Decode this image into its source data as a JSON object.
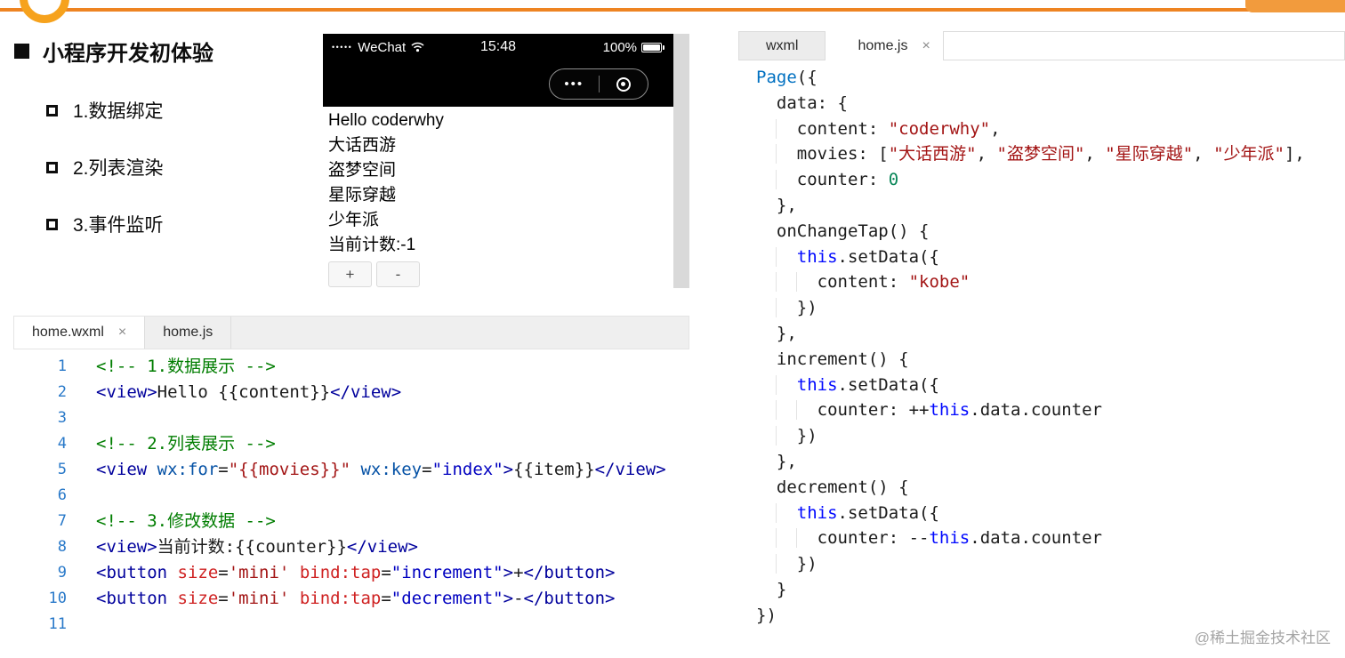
{
  "colors": {
    "accent_orange": "#ee8422",
    "comment_green": "#007d00",
    "tag_navy": "#00009c",
    "string_red": "#a31515",
    "number_green": "#098658",
    "keyword_blue": "#0008ff",
    "line_number_blue": "#2979c9"
  },
  "icons": {
    "close": "×",
    "capsule_dots": "•••",
    "signal_dots": "•••••"
  },
  "watermark": "@稀土掘金技术社区",
  "outline": {
    "title": "小程序开发初体验",
    "items": [
      "1.数据绑定",
      "2.列表渲染",
      "3.事件监听"
    ]
  },
  "phone": {
    "status": {
      "carrier": "WeChat",
      "time": "15:48",
      "battery": "100%"
    },
    "content_lines": [
      "Hello coderwhy",
      "大话西游",
      "盗梦空间",
      "星际穿越",
      "少年派",
      "当前计数:-1"
    ],
    "buttons": [
      "+",
      "-"
    ]
  },
  "wxml_editor": {
    "tabs": [
      {
        "label": "home.wxml",
        "active": true
      },
      {
        "label": "home.js",
        "active": false
      }
    ],
    "code": [
      {
        "n": "1",
        "tokens": [
          [
            "<!-- 1.数据展示 -->",
            "c"
          ]
        ]
      },
      {
        "n": "2",
        "tokens": [
          [
            "<view>",
            "t"
          ],
          [
            "Hello {{content}}",
            "p"
          ],
          [
            "</view>",
            "t"
          ]
        ]
      },
      {
        "n": "3",
        "tokens": []
      },
      {
        "n": "4",
        "tokens": [
          [
            "<!-- 2.列表展示 -->",
            "c"
          ]
        ]
      },
      {
        "n": "5",
        "tokens": [
          [
            "<view ",
            "t"
          ],
          [
            "wx:for",
            "a"
          ],
          [
            "=",
            "p"
          ],
          [
            "\"{{movies}}\"",
            "s"
          ],
          [
            " ",
            "p"
          ],
          [
            "wx:key",
            "a"
          ],
          [
            "=",
            "p"
          ],
          [
            "\"index\"",
            "sb"
          ],
          [
            ">",
            "t"
          ],
          [
            "{{item}}",
            "p"
          ],
          [
            "</view>",
            "t"
          ]
        ]
      },
      {
        "n": "6",
        "tokens": []
      },
      {
        "n": "7",
        "tokens": [
          [
            "<!-- 3.修改数据 -->",
            "c"
          ]
        ]
      },
      {
        "n": "8",
        "tokens": [
          [
            "<view>",
            "t"
          ],
          [
            "当前计数:{{counter}}",
            "p"
          ],
          [
            "</view>",
            "t"
          ]
        ]
      },
      {
        "n": "9",
        "tokens": [
          [
            "<button ",
            "t"
          ],
          [
            "size",
            "ar"
          ],
          [
            "=",
            "p"
          ],
          [
            "'mini'",
            "s"
          ],
          [
            " ",
            "p"
          ],
          [
            "bind:tap",
            "ar"
          ],
          [
            "=",
            "p"
          ],
          [
            "\"increment\"",
            "sb"
          ],
          [
            ">",
            "t"
          ],
          [
            "+",
            "p"
          ],
          [
            "</button>",
            "t"
          ]
        ]
      },
      {
        "n": "10",
        "tokens": [
          [
            "<button ",
            "t"
          ],
          [
            "size",
            "ar"
          ],
          [
            "=",
            "p"
          ],
          [
            "'mini'",
            "s"
          ],
          [
            " ",
            "p"
          ],
          [
            "bind:tap",
            "ar"
          ],
          [
            "=",
            "p"
          ],
          [
            "\"decrement\"",
            "sb"
          ],
          [
            ">",
            "t"
          ],
          [
            "-",
            "p"
          ],
          [
            "</button>",
            "t"
          ]
        ]
      },
      {
        "n": "11",
        "tokens": []
      }
    ]
  },
  "js_editor": {
    "tabs": [
      {
        "label": "wxml",
        "active": false
      },
      {
        "label": "home.js",
        "active": true
      }
    ],
    "code": [
      {
        "tokens": [
          [
            "Page",
            "f"
          ],
          [
            "({",
            "p"
          ]
        ]
      },
      {
        "tokens": [
          [
            "  ",
            "p"
          ],
          [
            "data: {",
            "p"
          ]
        ]
      },
      {
        "tokens": [
          [
            "    ",
            "p"
          ],
          [
            "content: ",
            "p"
          ],
          [
            "\"coderwhy\"",
            "s"
          ],
          [
            ",",
            "p"
          ]
        ]
      },
      {
        "tokens": [
          [
            "    ",
            "p"
          ],
          [
            "movies: [",
            "p"
          ],
          [
            "\"大话西游\"",
            "s"
          ],
          [
            ", ",
            "p"
          ],
          [
            "\"盗梦空间\"",
            "s"
          ],
          [
            ", ",
            "p"
          ],
          [
            "\"星际穿越\"",
            "s"
          ],
          [
            ", ",
            "p"
          ],
          [
            "\"少年派\"",
            "s"
          ],
          [
            "],",
            "p"
          ]
        ]
      },
      {
        "tokens": [
          [
            "    ",
            "p"
          ],
          [
            "counter: ",
            "p"
          ],
          [
            "0",
            "n"
          ]
        ]
      },
      {
        "tokens": [
          [
            "  ",
            "p"
          ],
          [
            "},",
            "p"
          ]
        ]
      },
      {
        "tokens": [
          [
            "  ",
            "p"
          ],
          [
            "onChangeTap() {",
            "p"
          ]
        ]
      },
      {
        "tokens": [
          [
            "    ",
            "p"
          ],
          [
            "this",
            "k"
          ],
          [
            ".setData({",
            "p"
          ]
        ]
      },
      {
        "tokens": [
          [
            "      ",
            "p"
          ],
          [
            "content: ",
            "p"
          ],
          [
            "\"kobe\"",
            "s"
          ]
        ]
      },
      {
        "tokens": [
          [
            "    ",
            "p"
          ],
          [
            "})",
            "p"
          ]
        ]
      },
      {
        "tokens": [
          [
            "  ",
            "p"
          ],
          [
            "},",
            "p"
          ]
        ]
      },
      {
        "tokens": [
          [
            "  ",
            "p"
          ],
          [
            "increment() {",
            "p"
          ]
        ]
      },
      {
        "tokens": [
          [
            "    ",
            "p"
          ],
          [
            "this",
            "k"
          ],
          [
            ".setData({",
            "p"
          ]
        ]
      },
      {
        "tokens": [
          [
            "      ",
            "p"
          ],
          [
            "counter: ++",
            "p"
          ],
          [
            "this",
            "k"
          ],
          [
            ".data.counter",
            "p"
          ]
        ]
      },
      {
        "tokens": [
          [
            "    ",
            "p"
          ],
          [
            "})",
            "p"
          ]
        ]
      },
      {
        "tokens": [
          [
            "  ",
            "p"
          ],
          [
            "},",
            "p"
          ]
        ]
      },
      {
        "tokens": [
          [
            "  ",
            "p"
          ],
          [
            "decrement() {",
            "p"
          ]
        ]
      },
      {
        "tokens": [
          [
            "    ",
            "p"
          ],
          [
            "this",
            "k"
          ],
          [
            ".setData({",
            "p"
          ]
        ]
      },
      {
        "tokens": [
          [
            "      ",
            "p"
          ],
          [
            "counter: --",
            "p"
          ],
          [
            "this",
            "k"
          ],
          [
            ".data.counter",
            "p"
          ]
        ]
      },
      {
        "tokens": [
          [
            "    ",
            "p"
          ],
          [
            "})",
            "p"
          ]
        ]
      },
      {
        "tokens": [
          [
            "  ",
            "p"
          ],
          [
            "}",
            "p"
          ]
        ]
      },
      {
        "tokens": [
          [
            "})",
            "p"
          ]
        ]
      }
    ]
  }
}
